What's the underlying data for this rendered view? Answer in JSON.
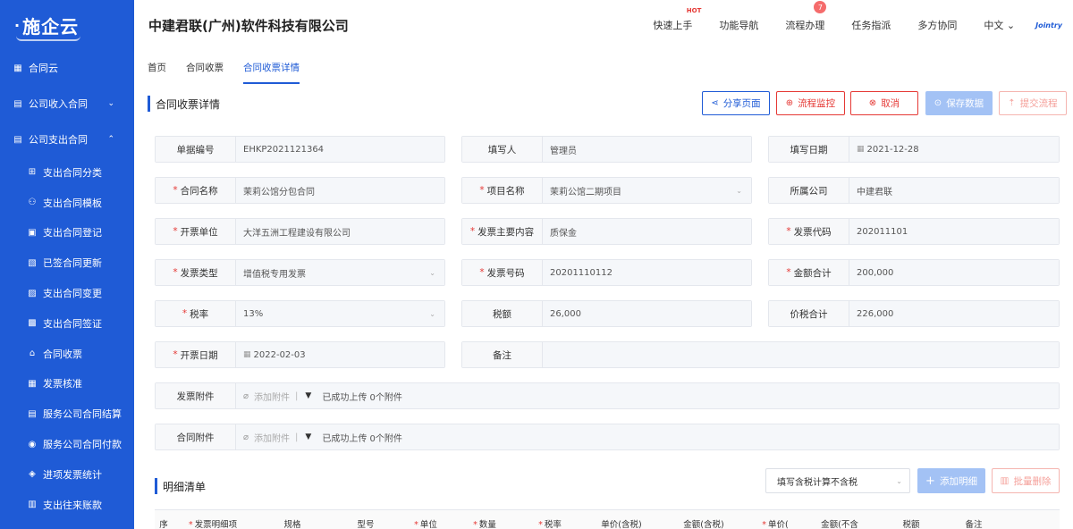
{
  "sidebar": {
    "logo": "施企云",
    "items": [
      {
        "label": "合同云",
        "icon": "grid-icon"
      },
      {
        "label": "公司收入合同",
        "icon": "contract-icon"
      },
      {
        "label": "公司支出合同",
        "icon": "contract-icon"
      }
    ],
    "sub_items": [
      {
        "label": "支出合同分类"
      },
      {
        "label": "支出合同模板"
      },
      {
        "label": "支出合同登记"
      },
      {
        "label": "已签合同更新"
      },
      {
        "label": "支出合同变更"
      },
      {
        "label": "支出合同签证"
      },
      {
        "label": "合同收票"
      },
      {
        "label": "发票核准"
      },
      {
        "label": "服务公司合同结算"
      },
      {
        "label": "服务公司合同付款"
      },
      {
        "label": "进项发票统计"
      },
      {
        "label": "支出往来账款"
      }
    ]
  },
  "header": {
    "company": "中建君联(广州)软件科技有限公司",
    "menu": [
      "快速上手",
      "功能导航",
      "流程办理",
      "任务指派",
      "多方协同"
    ],
    "hot_tag": "HOT",
    "badge_count": "7",
    "language": "中文",
    "brand": "Jointry"
  },
  "breadcrumb": [
    "首页",
    "合同收票",
    "合同收票详情"
  ],
  "section": {
    "title": "合同收票详情",
    "buttons": {
      "share": "分享页面",
      "monitor": "流程监控",
      "cancel": "取消",
      "save": "保存数据",
      "submit": "提交流程"
    }
  },
  "form": {
    "doc_no": {
      "label": "单据编号",
      "value": "EHKP2021121364"
    },
    "writer": {
      "label": "填写人",
      "value": "管理员"
    },
    "write_date": {
      "label": "填写日期",
      "value": "2021-12-28"
    },
    "contract_name": {
      "label": "合同名称",
      "value": "茉莉公馆分包合同"
    },
    "project_name": {
      "label": "项目名称",
      "value": "茉莉公馆二期项目"
    },
    "company": {
      "label": "所属公司",
      "value": "中建君联"
    },
    "issuer": {
      "label": "开票单位",
      "value": "大洋五洲工程建设有限公司"
    },
    "invoice_content": {
      "label": "发票主要内容",
      "value": "质保金"
    },
    "invoice_code": {
      "label": "发票代码",
      "value": "202011101"
    },
    "invoice_type": {
      "label": "发票类型",
      "value": "增值税专用发票"
    },
    "invoice_no": {
      "label": "发票号码",
      "value": "20201110112"
    },
    "amount_total": {
      "label": "金额合计",
      "value": "200,000"
    },
    "tax_rate": {
      "label": "税率",
      "value": "13%"
    },
    "tax_amount": {
      "label": "税额",
      "value": "26,000"
    },
    "price_tax_total": {
      "label": "价税合计",
      "value": "226,000"
    },
    "issue_date": {
      "label": "开票日期",
      "value": "2022-02-03"
    },
    "remark": {
      "label": "备注",
      "value": ""
    },
    "invoice_attach": {
      "label": "发票附件",
      "add": "添加附件",
      "status": "已成功上传 0个附件"
    },
    "contract_attach": {
      "label": "合同附件",
      "add": "添加附件",
      "status": "已成功上传 0个附件"
    }
  },
  "detail": {
    "title": "明细清单",
    "tax_select": "填写含税计算不含税",
    "add_button": "添加明细",
    "delete_button": "批量删除",
    "columns": [
      "序",
      "发票明细项",
      "规格",
      "型号",
      "单位",
      "数量",
      "税率",
      "单价(含税)",
      "金额(含税)",
      "单价(",
      "金额(不含",
      "税额",
      "备注"
    ]
  },
  "colors": {
    "sidebar": "#1f5bd6",
    "primary": "#1f5bd6",
    "danger": "#e53935"
  }
}
